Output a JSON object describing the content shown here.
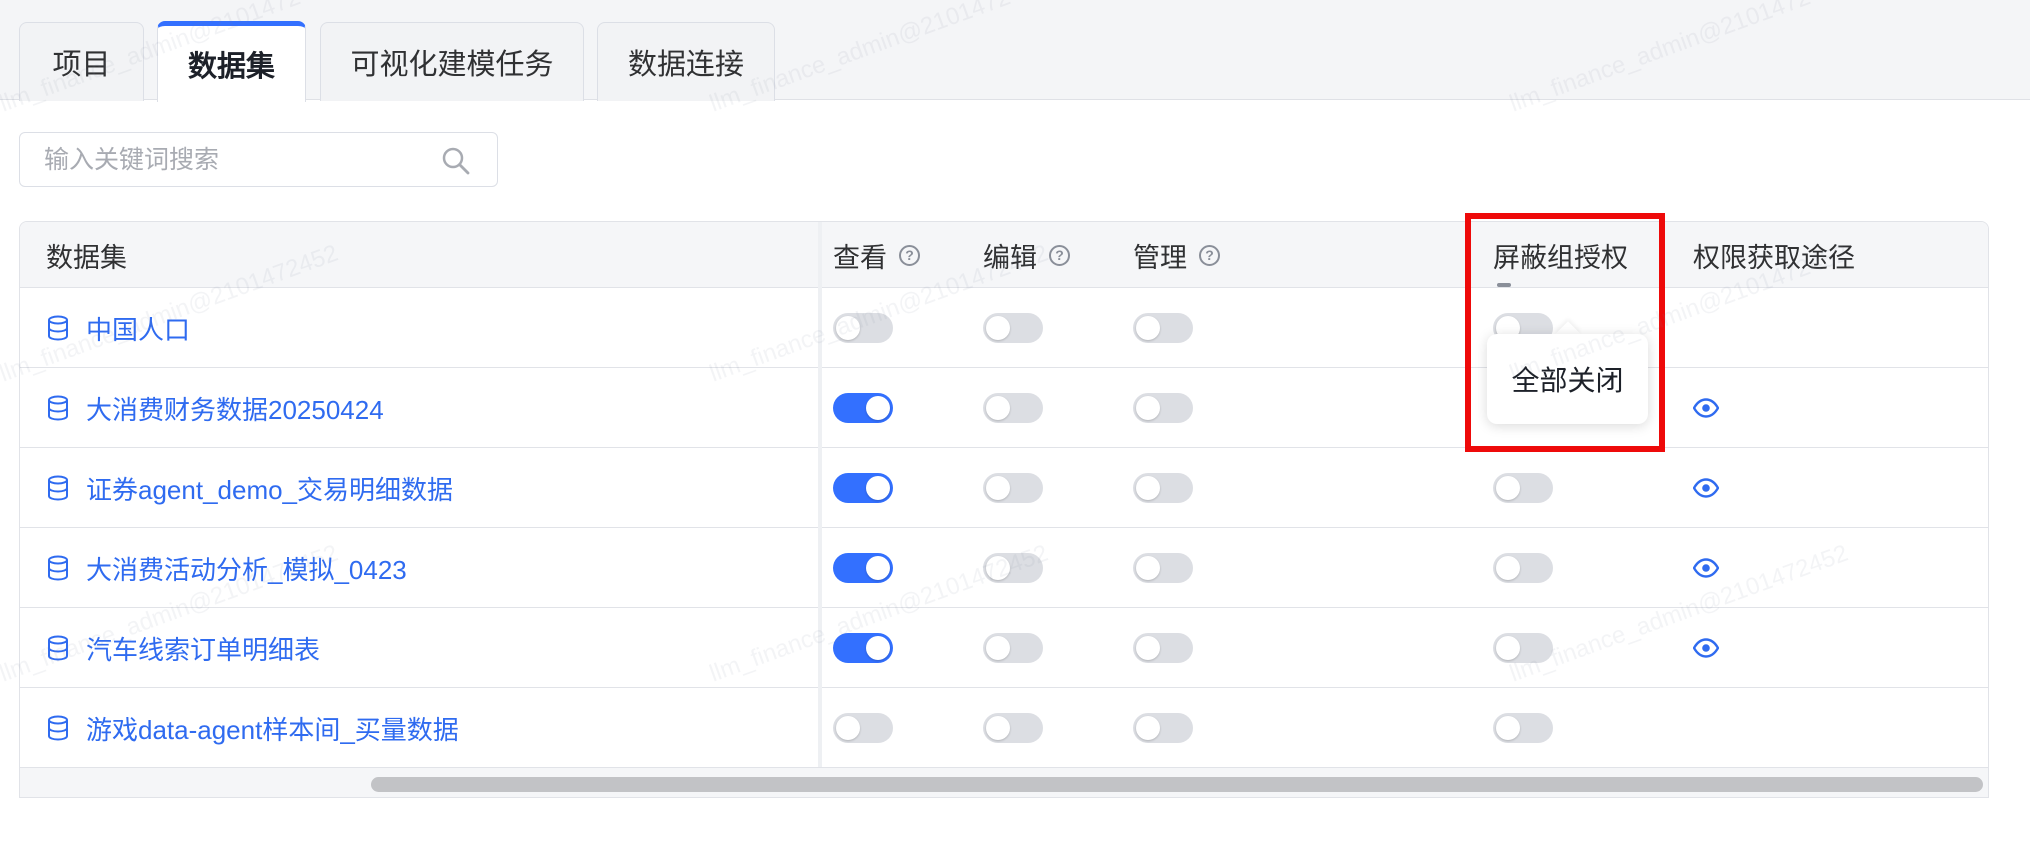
{
  "tabs": [
    {
      "label": "项目",
      "active": false
    },
    {
      "label": "数据集",
      "active": true
    },
    {
      "label": "可视化建模任务",
      "active": false
    },
    {
      "label": "数据连接",
      "active": false
    }
  ],
  "search": {
    "placeholder": "输入关键词搜索",
    "icon": "search-icon"
  },
  "table": {
    "headers": {
      "dataset": "数据集",
      "view": "查看",
      "edit": "编辑",
      "manage": "管理",
      "mask_group_auth": "屏蔽组授权",
      "permission_source": "权限获取途径"
    },
    "rows": [
      {
        "name": "中国人口",
        "view": false,
        "edit": false,
        "manage": false,
        "mask": false,
        "source_icon": false
      },
      {
        "name": "大消费财务数据20250424",
        "view": true,
        "edit": false,
        "manage": false,
        "mask": false,
        "source_icon": true
      },
      {
        "name": "证券agent_demo_交易明细数据",
        "view": true,
        "edit": false,
        "manage": false,
        "mask": false,
        "source_icon": true
      },
      {
        "name": "大消费活动分析_模拟_0423",
        "view": true,
        "edit": false,
        "manage": false,
        "mask": false,
        "source_icon": true
      },
      {
        "name": "汽车线索订单明细表",
        "view": true,
        "edit": false,
        "manage": false,
        "mask": false,
        "source_icon": true
      },
      {
        "name": "游戏data-agent样本间_买量数据",
        "view": false,
        "edit": false,
        "manage": false,
        "mask": false,
        "source_icon": false
      }
    ]
  },
  "popover": {
    "text": "全部关闭"
  },
  "colors": {
    "accent": "#3370ff",
    "link": "#2f6bf0",
    "highlight": "#ee0a0a"
  }
}
